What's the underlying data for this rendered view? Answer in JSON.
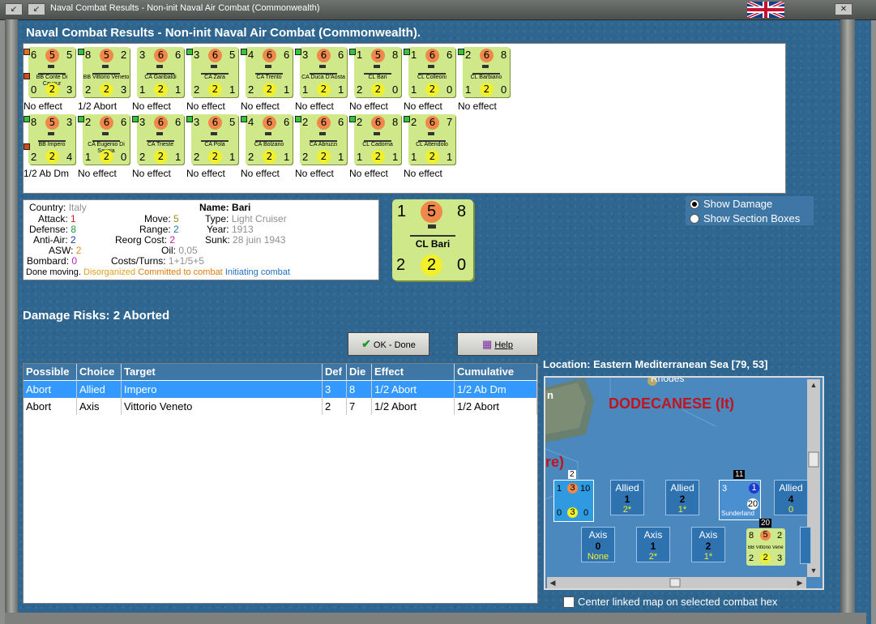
{
  "window": {
    "title": "Naval Combat Results - Non-init Naval Air Combat (Commonwealth)"
  },
  "heading": "Naval Combat Results - Non-init Naval Air Combat (Commonwealth).",
  "units_row1": [
    {
      "tl": "6",
      "atk": "5",
      "tr": "5",
      "name": "BB Conte Di Cavour",
      "bl": "0",
      "def": "2",
      "br": "3",
      "result": "No effect",
      "dot": "#e0701c"
    },
    {
      "tl": "8",
      "atk": "5",
      "tr": "2",
      "name": "BB Vittorio Veneto",
      "bl": "2",
      "def": "2",
      "br": "3",
      "result": "1/2 Abort",
      "dot": "#36c23a"
    },
    {
      "tl": "3",
      "atk": "6",
      "tr": "6",
      "name": "CA Garibaldi",
      "bl": "1",
      "def": "2",
      "br": "1",
      "result": "No effect",
      "dot": ""
    },
    {
      "tl": "3",
      "atk": "6",
      "tr": "5",
      "name": "CA Zara",
      "bl": "2",
      "def": "2",
      "br": "1",
      "result": "No effect",
      "dot": "#36c23a"
    },
    {
      "tl": "4",
      "atk": "6",
      "tr": "6",
      "name": "CA Trento",
      "bl": "2",
      "def": "2",
      "br": "1",
      "result": "No effect",
      "dot": "#36c23a"
    },
    {
      "tl": "3",
      "atk": "6",
      "tr": "6",
      "name": "CA Duca D'Aosta",
      "bl": "1",
      "def": "2",
      "br": "1",
      "result": "No effect",
      "dot": "#36c23a"
    },
    {
      "tl": "1",
      "atk": "5",
      "tr": "8",
      "name": "CL Bari",
      "bl": "2",
      "def": "2",
      "br": "0",
      "result": "No effect",
      "dot": "#36c23a"
    },
    {
      "tl": "1",
      "atk": "6",
      "tr": "6",
      "name": "CL Colleoni",
      "bl": "1",
      "def": "2",
      "br": "0",
      "result": "No effect",
      "dot": "#36c23a"
    },
    {
      "tl": "2",
      "atk": "6",
      "tr": "8",
      "name": "CL Barbiano",
      "bl": "1",
      "def": "2",
      "br": "0",
      "result": "No effect",
      "dot": "#36c23a"
    }
  ],
  "units_row2": [
    {
      "tl": "8",
      "atk": "5",
      "tr": "3",
      "name": "BB Impero",
      "bl": "2",
      "def": "2",
      "br": "4",
      "result": "1/2 Ab Dm",
      "dot": "#36c23a"
    },
    {
      "tl": "2",
      "atk": "6",
      "tr": "6",
      "name": "CA Eugenio Di Savoia",
      "bl": "1",
      "def": "2",
      "br": "0",
      "result": "No effect",
      "dot": "#36c23a"
    },
    {
      "tl": "3",
      "atk": "6",
      "tr": "6",
      "name": "CA Trieste",
      "bl": "2",
      "def": "2",
      "br": "1",
      "result": "No effect",
      "dot": "#36c23a"
    },
    {
      "tl": "3",
      "atk": "6",
      "tr": "5",
      "name": "CA Pola",
      "bl": "2",
      "def": "2",
      "br": "1",
      "result": "No effect",
      "dot": "#36c23a"
    },
    {
      "tl": "4",
      "atk": "6",
      "tr": "6",
      "name": "CA Bolzano",
      "bl": "2",
      "def": "2",
      "br": "1",
      "result": "No effect",
      "dot": "#36c23a"
    },
    {
      "tl": "2",
      "atk": "6",
      "tr": "6",
      "name": "CA Abruzzi",
      "bl": "2",
      "def": "2",
      "br": "1",
      "result": "No effect",
      "dot": "#36c23a"
    },
    {
      "tl": "2",
      "atk": "6",
      "tr": "8",
      "name": "CL Cadorna",
      "bl": "1",
      "def": "2",
      "br": "1",
      "result": "No effect",
      "dot": "#36c23a"
    },
    {
      "tl": "2",
      "atk": "6",
      "tr": "7",
      "name": "CL Attendolo",
      "bl": "1",
      "def": "2",
      "br": "1",
      "result": "No effect",
      "dot": "#36c23a"
    }
  ],
  "info": {
    "country_lbl": "Country:",
    "country": "Italy",
    "attack_lbl": "Attack:",
    "attack": "1",
    "defense_lbl": "Defense:",
    "defense": "8",
    "antiair_lbl": "Anti-Air:",
    "antiair": "2",
    "asw_lbl": "ASW:",
    "asw": "2",
    "bombard_lbl": "Bombard:",
    "bombard": "0",
    "name_lbl": "Name:",
    "name": "Bari",
    "type_lbl": "Type:",
    "type": "Light Cruiser",
    "year_lbl": "Year:",
    "year": "1913",
    "sunk_lbl": "Sunk:",
    "sunk": "28 juin 1943",
    "move_lbl": "Move:",
    "move": "5",
    "range_lbl": "Range:",
    "range": "2",
    "reorg_lbl": "Reorg Cost:",
    "reorg": "2",
    "oil_lbl": "Oil:",
    "oil": "0,05",
    "costs_lbl": "Costs/Turns:",
    "costs": "1+1/5+5",
    "status_done": "Done moving.",
    "status_dis": "Disorganized",
    "status_com": "Committed to combat",
    "status_init": "Initiating combat"
  },
  "big_counter": {
    "tl": "1",
    "atk": "5",
    "tr": "8",
    "name": "CL Bari",
    "bl": "2",
    "def": "2",
    "br": "0"
  },
  "radios": {
    "show_damage": "Show Damage",
    "show_sections": "Show Section Boxes"
  },
  "damage_risks": "Damage Risks:  2 Aborted",
  "buttons": {
    "ok": "OK - Done",
    "help": "Help"
  },
  "table": {
    "headers": [
      "Possible",
      "Choice",
      "Target",
      "Def",
      "Die",
      "Effect",
      "Cumulative"
    ],
    "rows": [
      [
        "Abort",
        "Allied",
        "Impero",
        "3",
        "8",
        "1/2 Abort",
        "1/2 Ab Dm"
      ],
      [
        "Abort",
        "Axis",
        "Vittorio Veneto",
        "2",
        "7",
        "1/2 Abort",
        "1/2 Abort"
      ]
    ]
  },
  "location": "Location:  Eastern Mediterranean Sea [79, 53]",
  "map": {
    "region": "DODECANESE (It)",
    "town": "Rhodes",
    "frag1": "re)",
    "frag2": "n",
    "allied_boxes": [
      {
        "side": "Allied",
        "val": "1",
        "sub": "2*"
      },
      {
        "side": "Allied",
        "val": "2",
        "sub": "1*"
      },
      {
        "side": "Allied",
        "val": "4",
        "sub": "0"
      }
    ],
    "axis_boxes": [
      {
        "side": "Axis",
        "val": "0",
        "sub": "None"
      },
      {
        "side": "Axis",
        "val": "1",
        "sub": "2*"
      },
      {
        "side": "Axis",
        "val": "2",
        "sub": "1*"
      }
    ],
    "stack1_count": "2",
    "stack2_count": "11",
    "stack3_count": "20",
    "unit_blue": {
      "tl": "1",
      "atk": "3",
      "tr": "10",
      "bl": "0",
      "def": "3",
      "br": "0"
    },
    "unit_bunderland": {
      "name": "Sunderland",
      "tl": "3",
      "tr": "1",
      "br": "20"
    },
    "unit_vv": {
      "tl": "8",
      "atk": "5",
      "tr": "2",
      "name": "BB Vittorio Veneto",
      "bl": "2",
      "def": "2",
      "br": "3"
    }
  },
  "center_linked": "Center linked map on selected combat hex",
  "colors": {
    "panel_blue": "#2f6690",
    "header_blue": "#3e76a6",
    "counter_green": "#cfe88a",
    "select_blue": "#3399ff"
  }
}
